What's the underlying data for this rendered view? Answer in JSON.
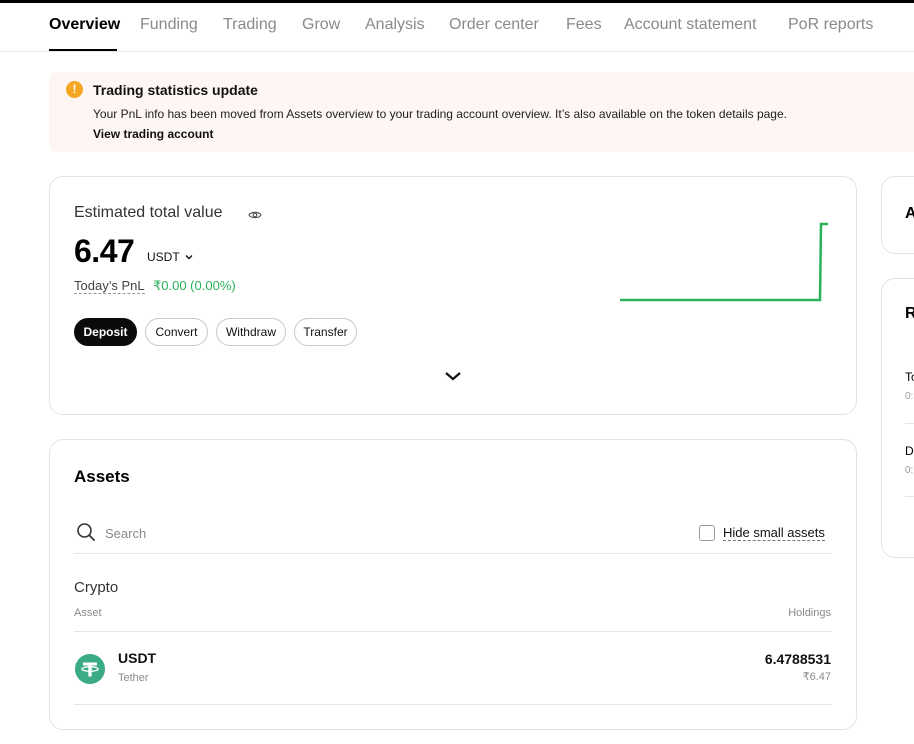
{
  "tabs": [
    {
      "label": "Overview",
      "active": true
    },
    {
      "label": "Funding"
    },
    {
      "label": "Trading"
    },
    {
      "label": "Grow"
    },
    {
      "label": "Analysis"
    },
    {
      "label": "Order center"
    },
    {
      "label": "Fees"
    },
    {
      "label": "Account statement"
    },
    {
      "label": "PoR reports"
    }
  ],
  "banner": {
    "icon": "!",
    "title": "Trading statistics update",
    "text": "Your PnL info has been moved from Assets overview to your trading account overview. It’s also available on the token details page.",
    "link": "View trading account"
  },
  "total": {
    "label": "Estimated total value",
    "value": "6.47",
    "currency": "USDT",
    "pnl_label": "Today’s PnL",
    "pnl_value": "₹0.00 (0.00%)",
    "pnl_color": "#2ab159",
    "actions": {
      "deposit": "Deposit",
      "convert": "Convert",
      "withdraw": "Withdraw",
      "transfer": "Transfer"
    }
  },
  "side": {
    "card1_letter": "A",
    "card2_letter": "R",
    "item1": "To",
    "item1_sub": "0:",
    "item2": "D",
    "item2_sub": "0:"
  },
  "assets": {
    "title": "Assets",
    "search_placeholder": "Search",
    "hide_small_label": "Hide small assets",
    "section": "Crypto",
    "col_asset": "Asset",
    "col_holdings": "Holdings",
    "rows": [
      {
        "symbol": "USDT",
        "name": "Tether",
        "amount": "6.4788531",
        "value": "₹6.47",
        "icon": "tether-icon",
        "icon_color": "#3bab85"
      }
    ]
  },
  "colors": {
    "accent_green": "#2ab159",
    "banner_bg": "#fdf6f2",
    "warning": "#f5a623"
  }
}
